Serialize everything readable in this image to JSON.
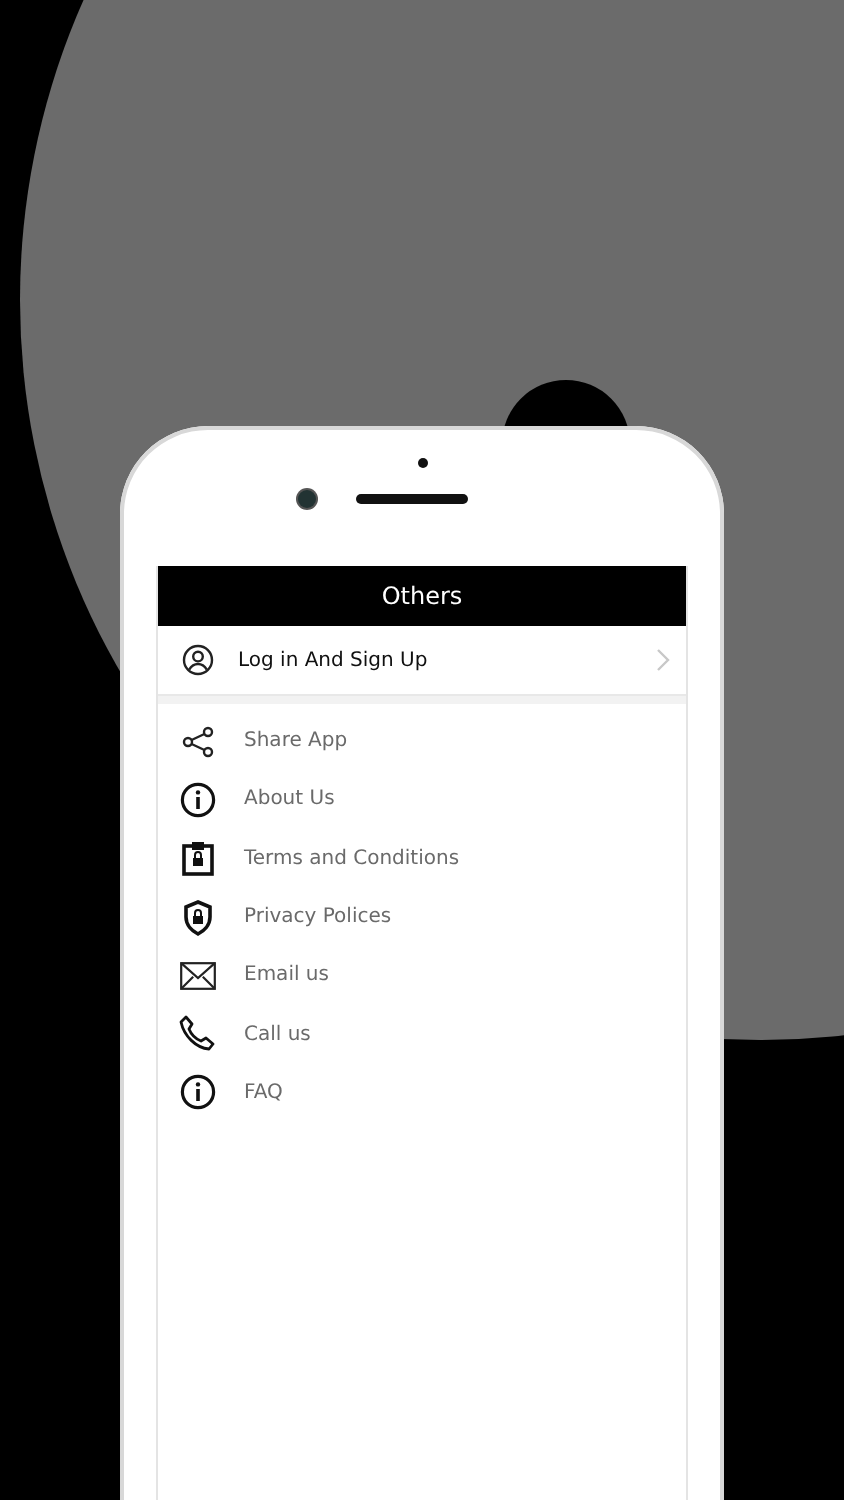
{
  "header": {
    "title": "Others"
  },
  "account": {
    "label": "Log in And Sign Up"
  },
  "menu": [
    {
      "label": "Share App"
    },
    {
      "label": "About Us"
    },
    {
      "label": "Terms and Conditions"
    },
    {
      "label": "Privacy Polices"
    },
    {
      "label": "Email us"
    },
    {
      "label": "Call us"
    },
    {
      "label": "FAQ"
    }
  ]
}
